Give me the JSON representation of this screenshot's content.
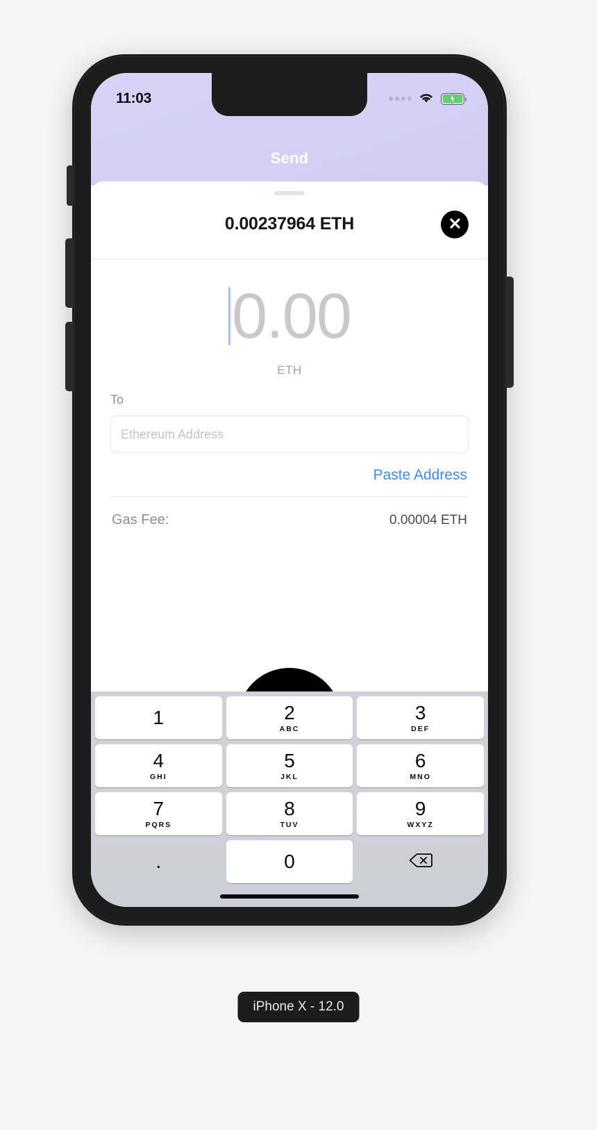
{
  "status_bar": {
    "time": "11:03",
    "signal_icon": "signal-dots-icon",
    "wifi_icon": "wifi-icon",
    "battery_icon": "battery-charging-icon"
  },
  "app": {
    "nav_title": "Send",
    "header_color": "#d3d0f3"
  },
  "sheet": {
    "balance": "0.00237964 ETH",
    "close_icon": "close-icon"
  },
  "amount": {
    "value": "0.00",
    "unit": "ETH",
    "caret_color": "#a8bff0",
    "placeholder_color": "#c9c9cc"
  },
  "form": {
    "to_label": "To",
    "address_value": "",
    "address_placeholder": "Ethereum Address",
    "paste_label": "Paste Address",
    "paste_color": "#3b8bf5",
    "gas_label": "Gas Fee:",
    "gas_value": "0.00004 ETH"
  },
  "keyboard": {
    "rows": [
      [
        {
          "num": "1",
          "sub": ""
        },
        {
          "num": "2",
          "sub": "ABC"
        },
        {
          "num": "3",
          "sub": "DEF"
        }
      ],
      [
        {
          "num": "4",
          "sub": "GHI"
        },
        {
          "num": "5",
          "sub": "JKL"
        },
        {
          "num": "6",
          "sub": "MNO"
        }
      ],
      [
        {
          "num": "7",
          "sub": "PQRS"
        },
        {
          "num": "8",
          "sub": "TUV"
        },
        {
          "num": "9",
          "sub": "WXYZ"
        }
      ],
      [
        {
          "num": ".",
          "sub": "",
          "style": "blank"
        },
        {
          "num": "0",
          "sub": ""
        },
        {
          "num": "",
          "sub": "",
          "style": "blank",
          "icon": "backspace-icon"
        }
      ]
    ]
  },
  "device": {
    "badge": "iPhone X - 12.0"
  }
}
